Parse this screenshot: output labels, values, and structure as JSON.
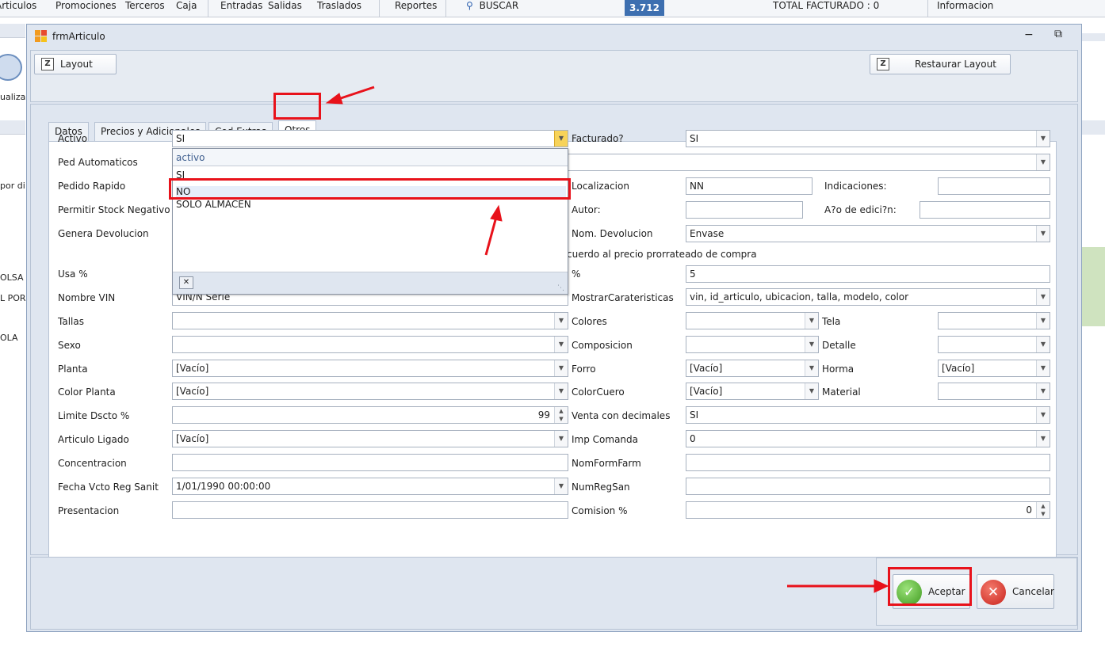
{
  "background": {
    "menu": [
      "Articulos",
      "Promociones",
      "Terceros",
      "Caja"
    ],
    "menu2": [
      "Entradas",
      "Salidas",
      "Traslados"
    ],
    "reportes": "Reportes",
    "buscar": "BUSCAR",
    "badge": "3.712",
    "total": "TOTAL FACTURADO : 0",
    "informacion": "Informacion",
    "left_texts": [
      "ualiza",
      "por di",
      "OLSA",
      "L POR",
      "OLA"
    ]
  },
  "window": {
    "title": "frmArticulo",
    "layout_button": "Layout",
    "restore_button": "Restaurar Layout"
  },
  "tabs": [
    "Datos",
    "Precios y Adicionales",
    "Cod Extras",
    "Otros"
  ],
  "left": {
    "activo": {
      "label": "Activo",
      "value": "SI"
    },
    "ped_auto": {
      "label": "Ped Automaticos"
    },
    "pedido_rapido": {
      "label": "Pedido Rapido"
    },
    "stock_negativo": {
      "label": "Permitir Stock Negativo"
    },
    "genera_devolucion": {
      "label": "Genera Devolucion"
    },
    "usa_pct": {
      "label": "Usa %"
    },
    "nombre_vin": {
      "label": "Nombre VIN",
      "value": "VIN/N Serie"
    },
    "tallas": {
      "label": "Tallas",
      "value": ""
    },
    "sexo": {
      "label": "Sexo",
      "value": ""
    },
    "planta": {
      "label": "Planta",
      "value": "[Vacío]"
    },
    "color_planta": {
      "label": "Color Planta",
      "value": "[Vacío]"
    },
    "limite_dscto": {
      "label": "Limite Dscto %",
      "value": "99"
    },
    "articulo_ligado": {
      "label": "Articulo Ligado",
      "value": "[Vacío]"
    },
    "concentracion": {
      "label": "Concentracion",
      "value": ""
    },
    "fecha_vcto": {
      "label": "Fecha Vcto Reg Sanit",
      "value": "1/01/1990 00:00:00"
    },
    "presentacion": {
      "label": "Presentacion",
      "value": ""
    }
  },
  "right": {
    "facturado": {
      "label": "Facturado?",
      "value": "SI"
    },
    "row2": {
      "value": ""
    },
    "localizacion": {
      "label": "Localizacion",
      "value": "NN"
    },
    "indicaciones": {
      "label": "Indicaciones:",
      "value": ""
    },
    "autor": {
      "label": "Autor:",
      "value": ""
    },
    "anio_edicion": {
      "label": "A?o de edici?n:",
      "value": ""
    },
    "nom_devolucion": {
      "label": "Nom. Devolucion",
      "value": "Envase"
    },
    "note": "cuerdo al precio prorrateado de compra",
    "pct": {
      "label": "%",
      "value": "5"
    },
    "mostrar": {
      "label": "MostrarCarateristicas",
      "value": "vin, id_articulo, ubicacion, talla, modelo, color"
    },
    "colores": {
      "label": "Colores",
      "value": ""
    },
    "tela": {
      "label": "Tela",
      "value": ""
    },
    "composicion": {
      "label": "Composicion",
      "value": ""
    },
    "detalle": {
      "label": "Detalle",
      "value": ""
    },
    "forro": {
      "label": "Forro",
      "value": "[Vacío]"
    },
    "horma": {
      "label": "Horma",
      "value": "[Vacío]"
    },
    "colorcuero": {
      "label": "ColorCuero",
      "value": "[Vacío]"
    },
    "material": {
      "label": "Material",
      "value": ""
    },
    "venta_decimales": {
      "label": "Venta con decimales",
      "value": "SI"
    },
    "imp_comanda": {
      "label": "Imp Comanda",
      "value": "0"
    },
    "nomformfarm": {
      "label": "NomFormFarm",
      "value": ""
    },
    "numregsan": {
      "label": "NumRegSan",
      "value": ""
    },
    "comision": {
      "label": "Comision %",
      "value": "0"
    }
  },
  "popup": {
    "header": "activo",
    "options": [
      "SI",
      "NO",
      "SOLO ALMACEN"
    ],
    "selected": "NO"
  },
  "buttons": {
    "aceptar": "Aceptar",
    "cancelar": "Cancelar"
  },
  "colors": {
    "annotation_red": "#e8121b",
    "accept_green": "#4caf2a",
    "cancel_red": "#d8322b"
  }
}
